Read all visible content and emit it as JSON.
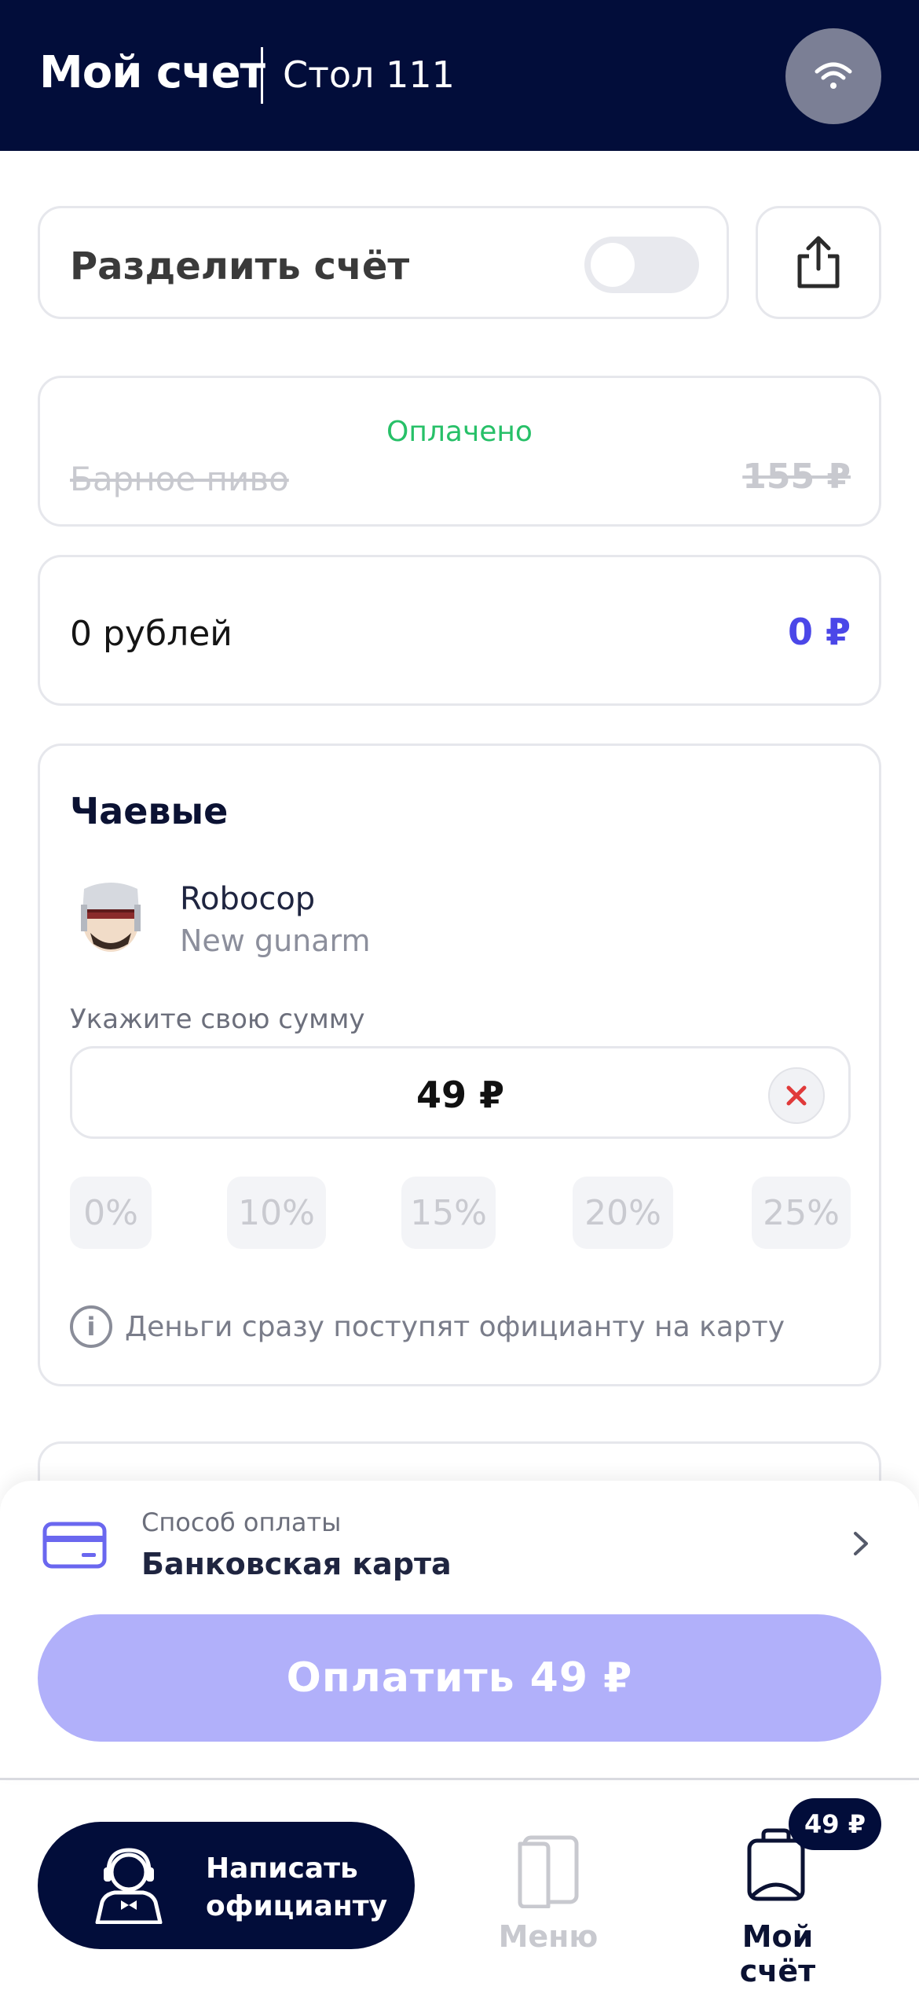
{
  "header": {
    "title": "Мой счет",
    "table": "Стол 111"
  },
  "split": {
    "label": "Разделить счёт",
    "enabled": false
  },
  "paid_item": {
    "status": "Оплачено",
    "name": "Барное пиво",
    "price": "155 ₽"
  },
  "sum_row": {
    "label": "0 рублей",
    "value": "0 ₽"
  },
  "tips": {
    "title": "Чаевые",
    "waiter_name": "Robocop",
    "waiter_role": "New gunarm",
    "amount_label": "Укажите свою сумму",
    "amount_value": "49 ₽",
    "percents": [
      "0%",
      "10%",
      "15%",
      "20%",
      "25%"
    ],
    "info": "Деньги сразу поступят официанту на карту"
  },
  "payment": {
    "method_label": "Способ оплаты",
    "method_value": "Банковская карта",
    "pay_button": "Оплатить 49 ₽"
  },
  "nav": {
    "call_waiter": "Написать официанту",
    "menu": "Меню",
    "bill": "Мой счёт",
    "bill_badge": "49 ₽"
  },
  "colors": {
    "header_bg": "#020d3a",
    "accent": "#4b47e8",
    "pay_button": "#b1b0fa",
    "paid_green": "#27c068"
  }
}
